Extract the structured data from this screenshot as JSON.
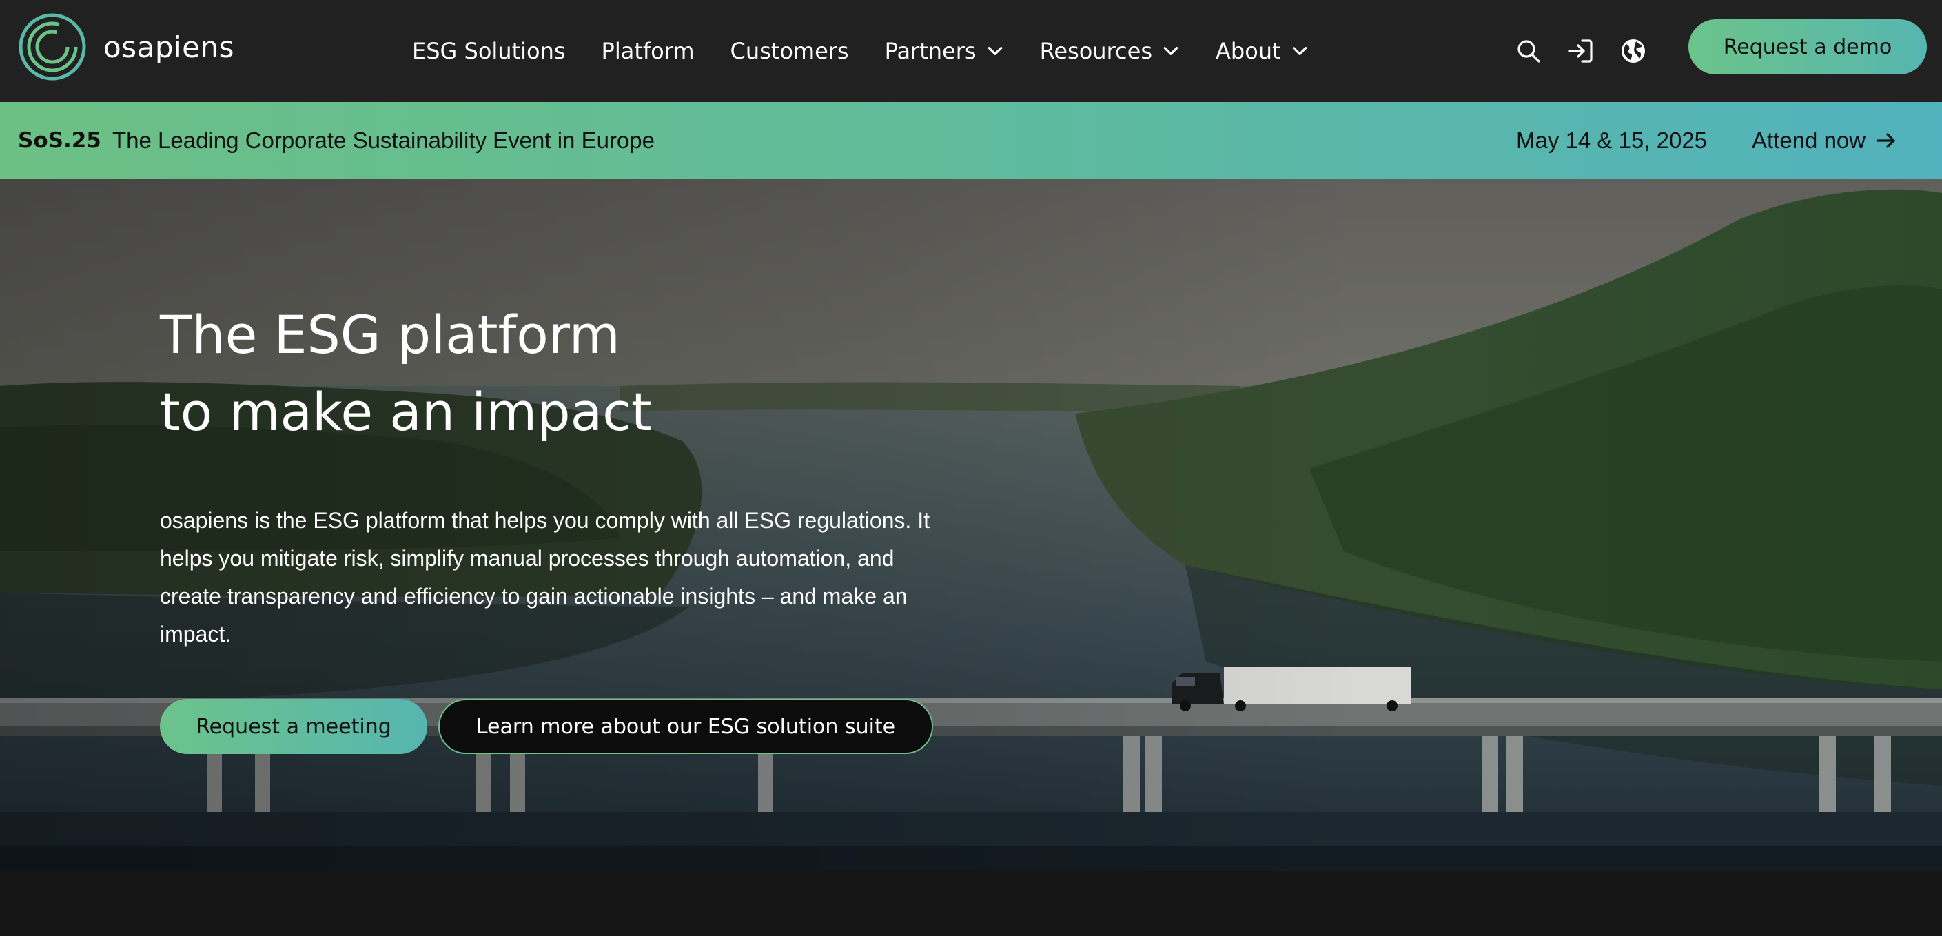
{
  "brand": {
    "name": "osapiens"
  },
  "nav": {
    "items": [
      {
        "label": "ESG Solutions",
        "dropdown": false
      },
      {
        "label": "Platform",
        "dropdown": false
      },
      {
        "label": "Customers",
        "dropdown": false
      },
      {
        "label": "Partners",
        "dropdown": true
      },
      {
        "label": "Resources",
        "dropdown": true
      },
      {
        "label": "About",
        "dropdown": true
      }
    ],
    "icons": [
      "search-icon",
      "login-icon",
      "globe-icon"
    ],
    "cta_label": "Request a demo"
  },
  "banner": {
    "tag": "SoS.25",
    "text": "The Leading Corporate Sustainability Event in Europe",
    "date": "May 14 & 15, 2025",
    "cta": "Attend now"
  },
  "hero": {
    "title_line1": "The ESG platform",
    "title_line2": "to make an impact",
    "description": "osapiens is the ESG platform that helps you comply with all ESG regulations. It helps you mitigate risk, simplify manual processes through automation, and create transparency and efficiency to gain actionable insights – and make an impact.",
    "primary_cta": "Request a meeting",
    "secondary_cta": "Learn more about our ESG solution suite"
  },
  "colors": {
    "nav_bg": "#212121",
    "accent_green": "#6cc38a",
    "accent_teal": "#56b6b0",
    "page_bg": "#141414"
  }
}
